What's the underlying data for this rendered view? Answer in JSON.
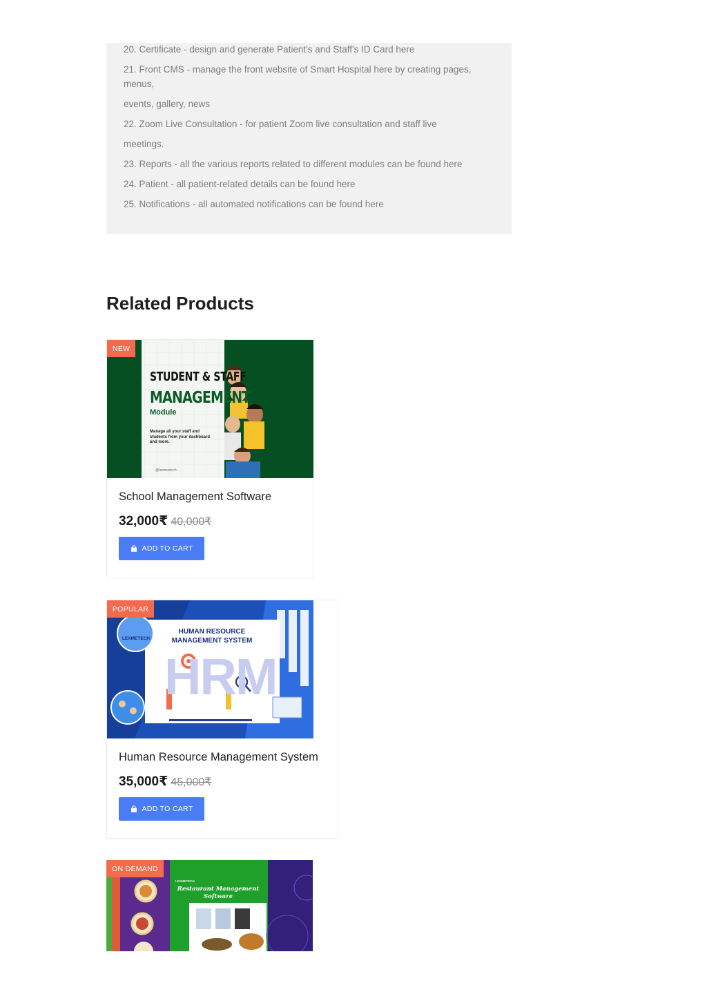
{
  "description": {
    "lines": [
      "20. Certificate - design and generate Patient's and Staff's ID Card here",
      "21. Front CMS - manage the front website of Smart Hospital here by creating pages,",
      "menus,",
      "events, gallery, news",
      "22. Zoom Live Consultation - for patient Zoom live consultation and staff live",
      "meetings.",
      "23. Reports - all the various reports related to different modules can be found here",
      "24. Patient - all patient-related details can be found here",
      "25. Notifications - all automated notifications can be found here"
    ]
  },
  "related": {
    "heading": "Related Products",
    "products": [
      {
        "badge": "NEW",
        "title": "School Management Software",
        "price": "32,000₹",
        "old_price": "40,000₹",
        "button": "ADD TO CART",
        "image": {
          "line1": "STUDENT & STAFF",
          "line2": "MANAGEMENT",
          "line3": "Module",
          "tagline": "Manage all your staff and students from your dashboard and more.",
          "brand": "@lexmetech"
        }
      },
      {
        "badge": "POPULAR",
        "title": "Human Resource Management System",
        "price": "35,000₹",
        "old_price": "45,000₹",
        "button": "ADD TO CART",
        "image": {
          "logo": "LEXMETECH",
          "line1": "HUMAN RESOURCE",
          "line2": "MANAGEMENT SYSTEM",
          "big": "HRM"
        }
      },
      {
        "badge": "ON DEMAND",
        "image": {
          "logo": "LEXMETECH",
          "line1": "Restaurant Management",
          "line2": "Software"
        }
      }
    ]
  },
  "colors": {
    "badge": "#f26b4f",
    "button": "#4a7cf6",
    "desc_bg": "#f1f1f1",
    "school_green": "#064f22",
    "hrm_blue": "#1d4fb8"
  }
}
